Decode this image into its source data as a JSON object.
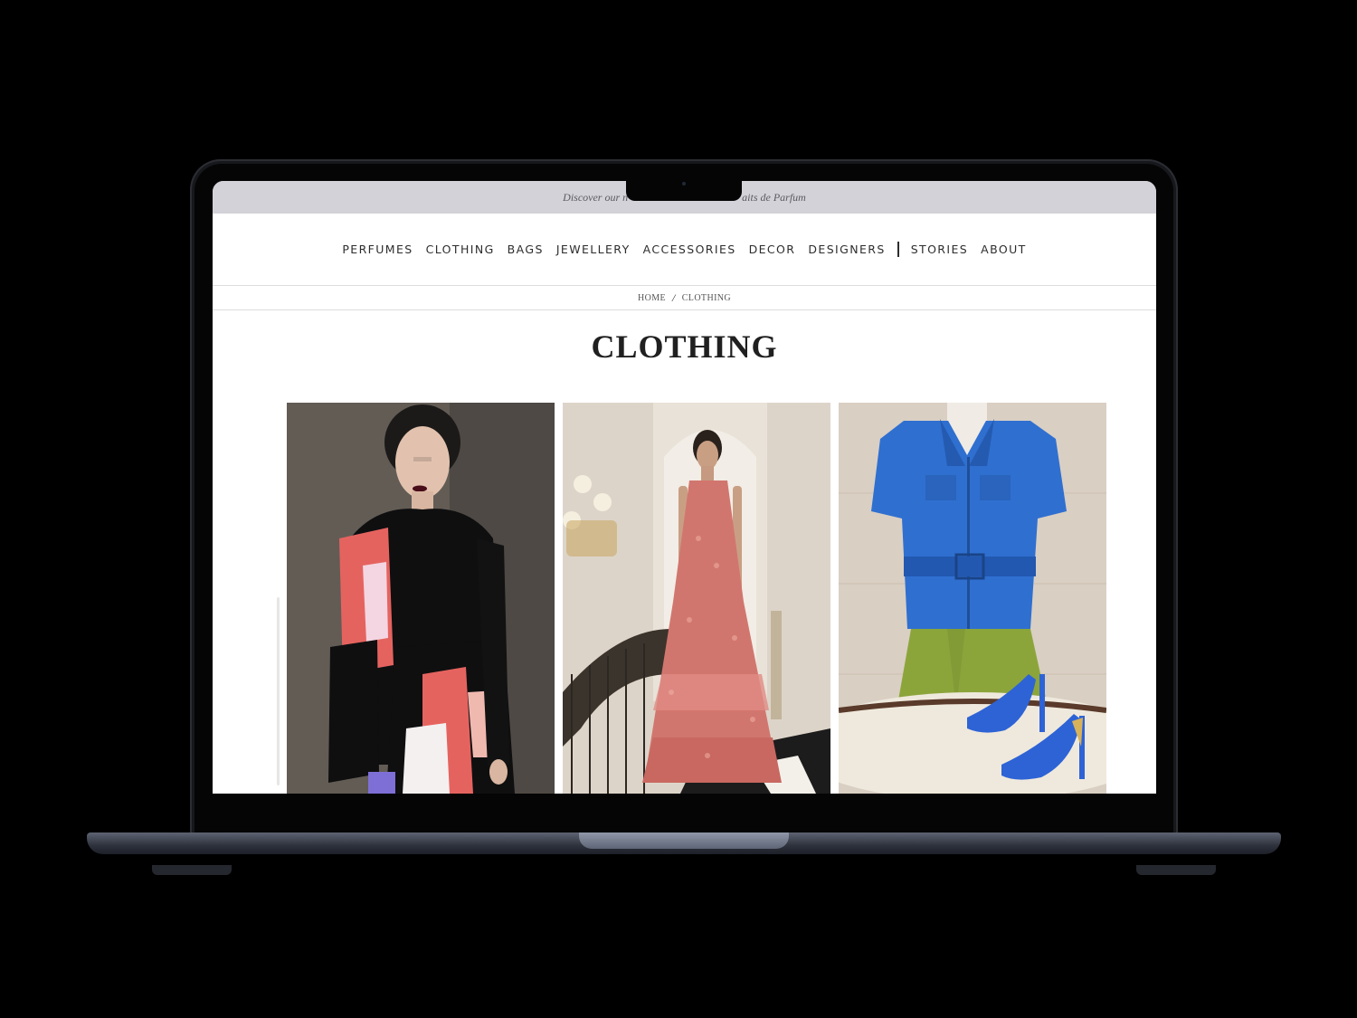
{
  "announcement": {
    "text_left": "Discover our n",
    "text_right": "aits de Parfum"
  },
  "nav": {
    "items": [
      "PERFUMES",
      "CLOTHING",
      "BAGS",
      "JEWELLERY",
      "ACCESSORIES",
      "DECOR",
      "DESIGNERS"
    ],
    "secondary_items": [
      "STORIES",
      "ABOUT"
    ]
  },
  "breadcrumb": {
    "home": "HOME",
    "separator": "/",
    "current": "CLOTHING"
  },
  "page": {
    "title": "CLOTHING"
  },
  "products": [
    {
      "image": "model-black-shirt-pink-print-look"
    },
    {
      "image": "model-coral-tiered-gown-look"
    },
    {
      "image": "blue-leather-shirt-jacket-green-skirt-blue-heels"
    }
  ],
  "colors": {
    "announcement_bg": "#d3d2d8",
    "nav_text": "#2d2d2d",
    "title_text": "#202020",
    "laptop_body": "#2e323c"
  }
}
